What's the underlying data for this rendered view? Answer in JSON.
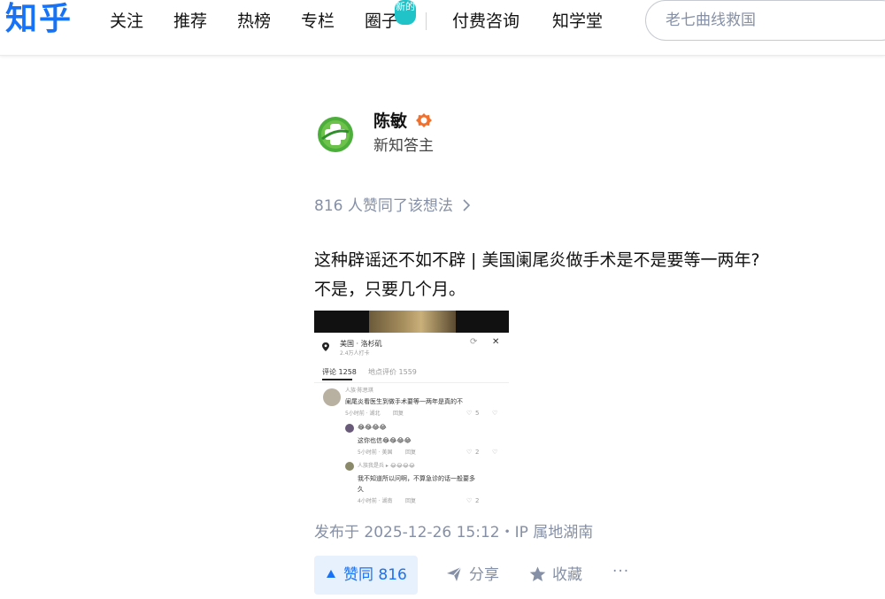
{
  "header": {
    "logo": "知乎",
    "nav": [
      {
        "label": "关注"
      },
      {
        "label": "推荐"
      },
      {
        "label": "热榜"
      },
      {
        "label": "专栏"
      },
      {
        "label": "圈子"
      },
      {
        "label": "付费咨询"
      },
      {
        "label": "知学堂"
      }
    ],
    "new_badge": "新的",
    "search": {
      "placeholder": "老七曲线救国"
    }
  },
  "author": {
    "name": "陈敏",
    "title": "新知答主",
    "avatar_icon": "green-plus-logo-icon",
    "badge_icon": "verified-badge-icon"
  },
  "likes_summary": "816 人赞同了该想法",
  "post": {
    "lines": [
      "这种辟谣还不如不辟 | 美国阑尾炎做手术是不是要等一两年?",
      "不是，只要几个月。"
    ],
    "image": {
      "location": "美国 · 洛杉矶",
      "location_sub": "2.4万人打卡",
      "tab_comments": "评论 1258",
      "tab_reviews": "地点评价 1559",
      "comments": [
        {
          "user": "人族·陈思琪",
          "text": "阑尾炎看医生到做手术要等一两年是真的不",
          "meta": "5小时前 · 湖北",
          "reply": "回复",
          "likes": "5"
        },
        {
          "user": "😂😂😂😂",
          "text": "这你也信😂😂😂😂",
          "meta": "5小时前 · 美国",
          "reply": "回复",
          "likes": "2"
        },
        {
          "user": "人族我是兵 ▸ 😂😂😂😂",
          "text": "我不知道所以问啊，不算急诊的话一般要多",
          "text2": "久",
          "meta": "4小时前 · 湖南",
          "reply": "回复",
          "likes": "2"
        }
      ]
    }
  },
  "meta": "发布于 2025-12-26 15:12・IP 属地湖南",
  "actions": {
    "vote_label": "赞同 816",
    "share_label": "分享",
    "favorite_label": "收藏",
    "more_label": "···"
  },
  "colors": {
    "brand": "#1772f6",
    "badge": "#1fc3c8",
    "muted": "#8590a6",
    "vote_bg": "#e7f0fd"
  }
}
